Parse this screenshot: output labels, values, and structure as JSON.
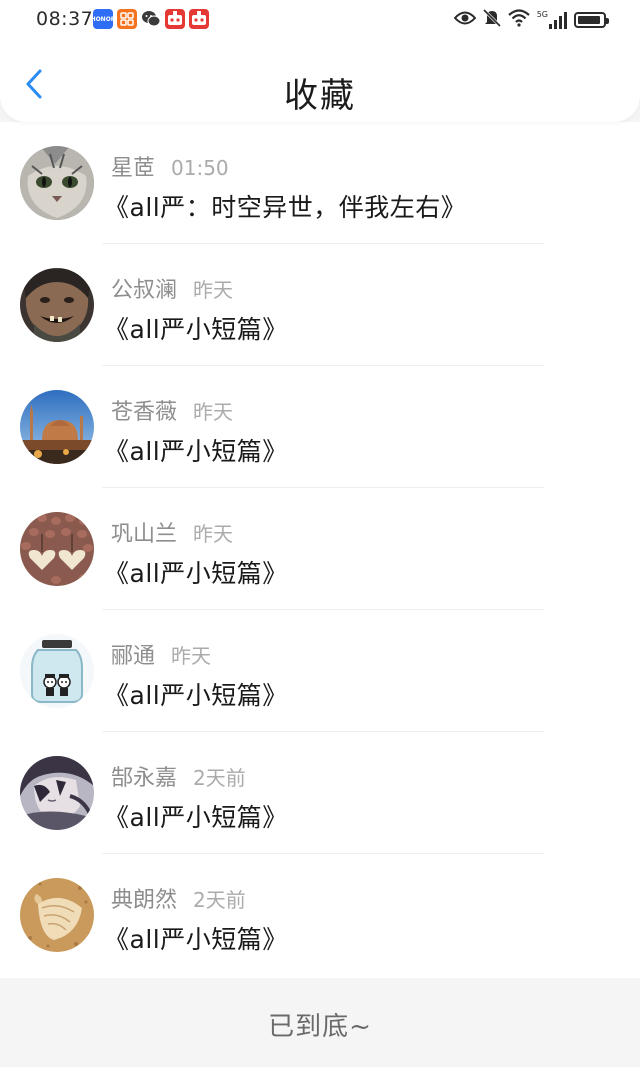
{
  "status_bar": {
    "time": "08:37",
    "network": "5G",
    "apps": [
      "honor-icon",
      "taobao-icon",
      "wechat-icon",
      "red-app-icon",
      "red-app-icon"
    ],
    "battery_level": 0.92
  },
  "header": {
    "title": "收藏"
  },
  "list": {
    "items": [
      {
        "name": "星茝",
        "time": "01:50",
        "title": "《all严：时空异世，伴我左右》",
        "avatar": "cat-avatar"
      },
      {
        "name": "公叔澜",
        "time": "昨天",
        "title": "《all严小短篇》",
        "avatar": "smiling-man-avatar"
      },
      {
        "name": "苍香薇",
        "time": "昨天",
        "title": "《all严小短篇》",
        "avatar": "mosque-avatar"
      },
      {
        "name": "巩山兰",
        "time": "昨天",
        "title": "《all严小短篇》",
        "avatar": "beans-hearts-avatar"
      },
      {
        "name": "郦通",
        "time": "昨天",
        "title": "《all严小短篇》",
        "avatar": "jar-cartoon-avatar"
      },
      {
        "name": "郜永嘉",
        "time": "2天前",
        "title": "《all严小短篇》",
        "avatar": "anime-boy-avatar"
      },
      {
        "name": "典朗然",
        "time": "2天前",
        "title": "《all严小短篇》",
        "avatar": "shell-avatar"
      }
    ]
  },
  "footer": {
    "text": "已到底~"
  },
  "colors": {
    "back_arrow": "#2a8cf0",
    "background": "#f5f5f6"
  }
}
